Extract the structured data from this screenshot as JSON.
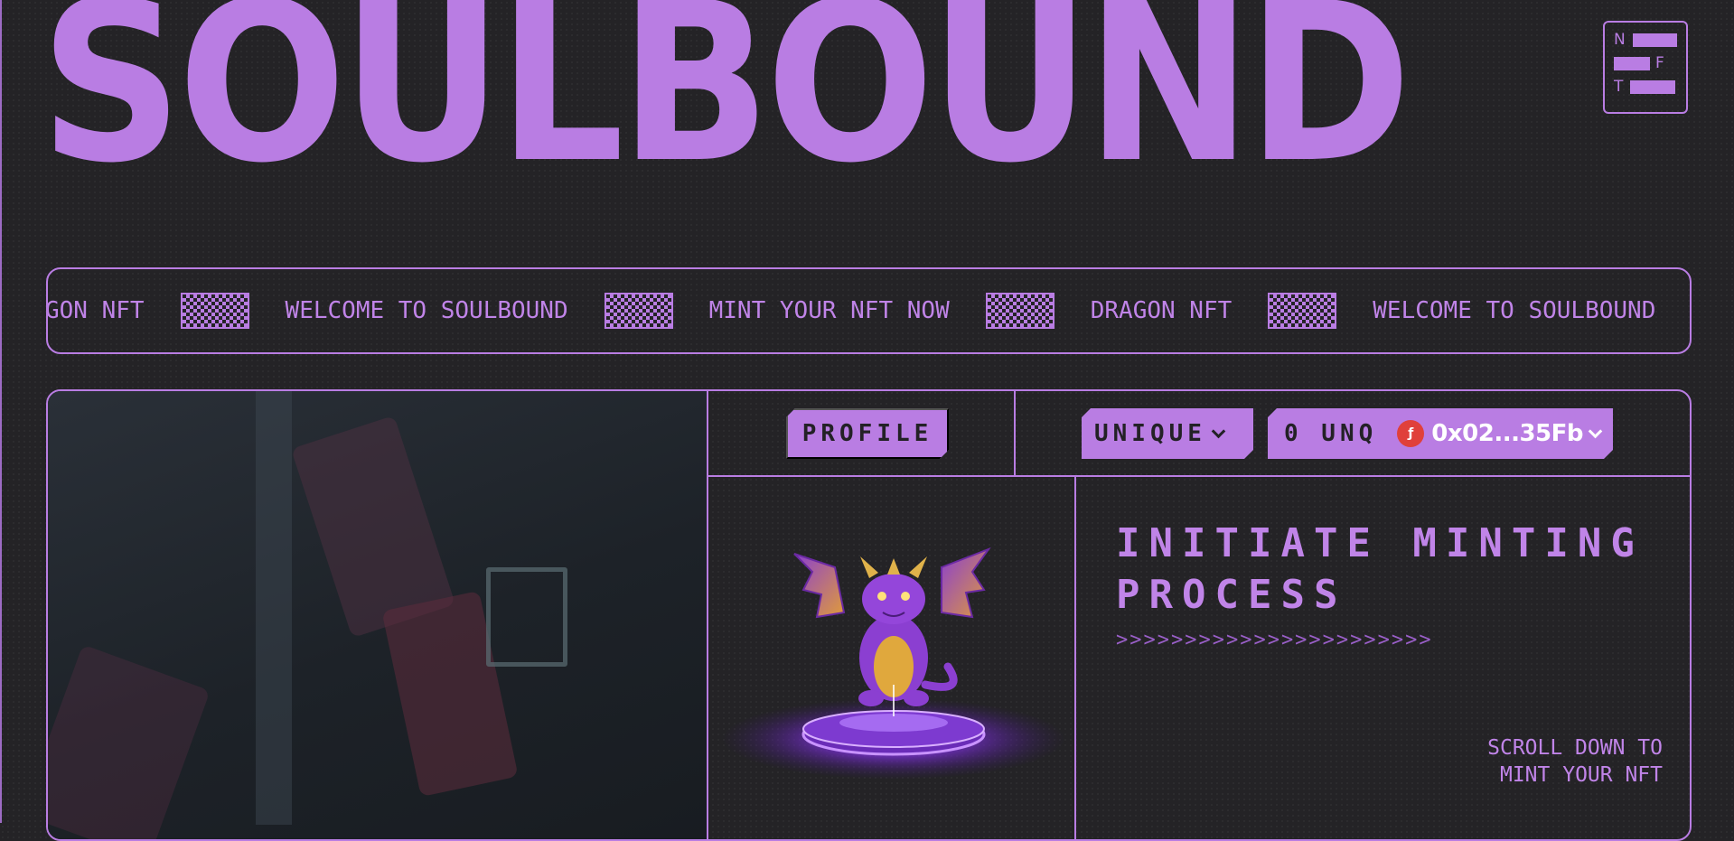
{
  "hero": {
    "title": "SOULBOUND",
    "badge_letters": [
      "N",
      "F",
      "T"
    ]
  },
  "ticker": {
    "items": [
      "DRAGON NFT",
      "WELCOME TO SOULBOUND",
      "MINT YOUR NFT NOW",
      "DRAGON NFT",
      "WELCOME TO SOULBOUND"
    ]
  },
  "nav": {
    "profile_label": "PROFILE",
    "unique_label": "UNIQUE",
    "balance": "0 UNQ",
    "wallet_address": "0x02...35Fb"
  },
  "mint": {
    "title": "INITIATE MINTING PROCESS",
    "arrows": ">>>>>>>>>>>>>>>>>>>>>>>",
    "scroll_hint": "SCROLL DOWN TO MINT YOUR NFT"
  },
  "icons": {
    "token": "red-coin-icon",
    "dropdown": "chevron-down-icon",
    "separator": "pixel-pattern-icon"
  },
  "colors": {
    "accent": "#b97de3",
    "background": "#242326",
    "token": "#e0403a"
  }
}
